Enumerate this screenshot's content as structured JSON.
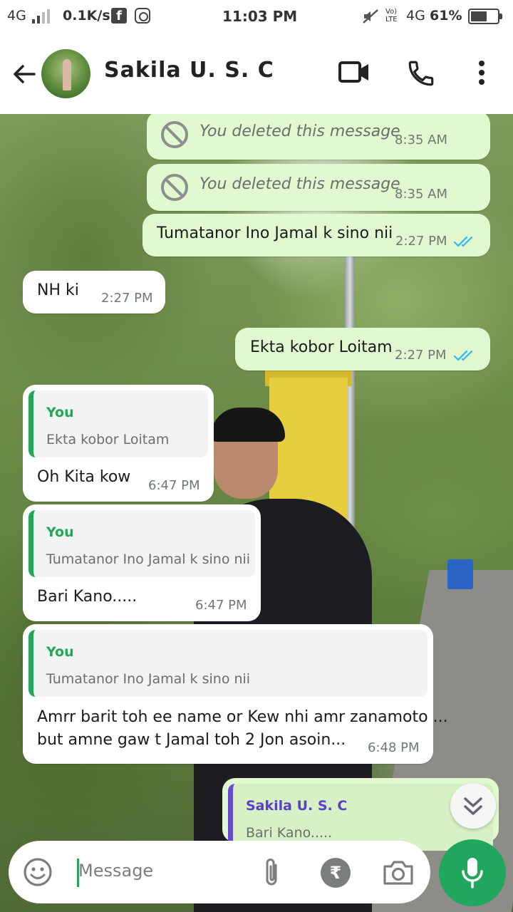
{
  "status_bar": {
    "network_left": "4G",
    "speed": "0.1K/s",
    "time": "11:03 PM",
    "volte": "Vo) LTE",
    "network_right": "4G",
    "battery": "61%",
    "battery_level": 0.61
  },
  "header": {
    "contact_name": "Sakila U. S. C"
  },
  "messages": [
    {
      "direction": "out",
      "deleted": true,
      "text": "You deleted this message",
      "time": "8:35 AM"
    },
    {
      "direction": "out",
      "deleted": true,
      "text": "You deleted this message",
      "time": "8:35 AM"
    },
    {
      "direction": "out",
      "text": "Tumatanor Ino Jamal k sino nii",
      "time": "2:27 PM",
      "read": true
    },
    {
      "direction": "in",
      "text": "NH ki",
      "time": "2:27 PM"
    },
    {
      "direction": "out",
      "text": "Ekta kobor Loitam",
      "time": "2:27 PM",
      "read": true
    },
    {
      "direction": "in",
      "quote_name": "You",
      "quote_text": "Ekta kobor Loitam",
      "text": "Oh Kita kow",
      "time": "6:47 PM"
    },
    {
      "direction": "in",
      "quote_name": "You",
      "quote_text": "Tumatanor Ino Jamal k sino nii",
      "text": "Bari Kano.....",
      "time": "6:47 PM"
    },
    {
      "direction": "in",
      "quote_name": "You",
      "quote_text": "Tumatanor Ino Jamal k sino nii",
      "text_line1": "Amrr barit toh ee name or Kew nhi amr zanamoto ...",
      "text_line2": "but amne gaw t Jamal toh 2 Jon asoin...",
      "time": "6:48 PM"
    },
    {
      "direction": "out",
      "quote_name": "Sakila U. S. C",
      "quote_text": "Bari Kano....."
    }
  ],
  "composer": {
    "placeholder": "Message"
  },
  "icons": {
    "back": "arrow-left-icon",
    "video": "video-call-icon",
    "phone": "phone-icon",
    "menu": "more-vert-icon",
    "emoji": "emoji-icon",
    "attach": "paperclip-icon",
    "payment": "rupee-icon",
    "camera": "camera-icon",
    "mic": "mic-icon",
    "scroll": "chevron-double-down-icon"
  },
  "colors": {
    "accent": "#21a65d",
    "outgoing_bubble": "#e1f8d0",
    "incoming_bubble": "#ffffff",
    "read_ticks": "#34b7f1"
  }
}
